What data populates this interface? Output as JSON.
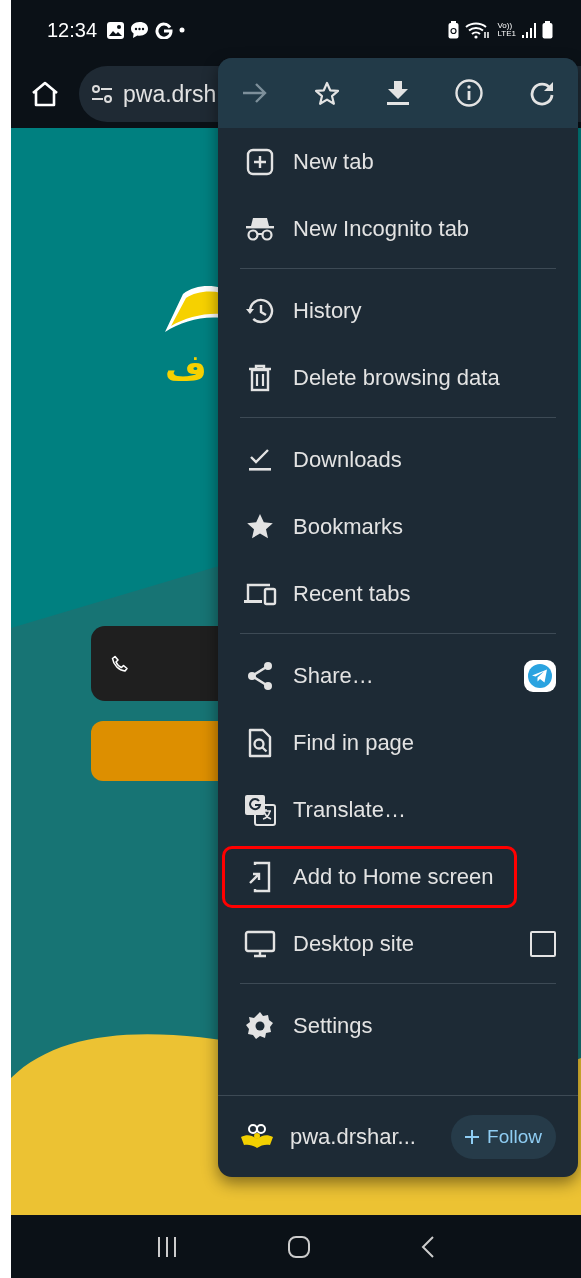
{
  "status_bar": {
    "time": "12:34",
    "network_label_top": "Vo))",
    "network_label_bottom": "LTE1"
  },
  "toolbar": {
    "url": "pwa.drsh"
  },
  "page": {
    "logo_text": "ف"
  },
  "menu": {
    "actions": [
      {
        "kind": "forward",
        "disabled": true
      },
      {
        "kind": "bookmark",
        "disabled": false
      },
      {
        "kind": "download",
        "disabled": false
      },
      {
        "kind": "info",
        "disabled": false
      },
      {
        "kind": "reload",
        "disabled": false
      }
    ],
    "sections": [
      {
        "items": [
          {
            "kind": "new-tab",
            "label": "New tab",
            "highlighted": false
          },
          {
            "kind": "incognito",
            "label": "New Incognito tab",
            "highlighted": false
          }
        ]
      },
      {
        "items": [
          {
            "kind": "history",
            "label": "History",
            "highlighted": false
          },
          {
            "kind": "delete",
            "label": "Delete browsing data",
            "highlighted": false
          }
        ]
      },
      {
        "items": [
          {
            "kind": "downloads",
            "label": "Downloads",
            "highlighted": false
          },
          {
            "kind": "bookmarks",
            "label": "Bookmarks",
            "highlighted": false
          },
          {
            "kind": "recent",
            "label": "Recent tabs",
            "highlighted": false
          }
        ]
      },
      {
        "items": [
          {
            "kind": "share",
            "label": "Share…",
            "highlighted": false
          },
          {
            "kind": "find",
            "label": "Find in page",
            "highlighted": false
          },
          {
            "kind": "translate",
            "label": "Translate…",
            "highlighted": false
          },
          {
            "kind": "add-home",
            "label": "Add to Home screen",
            "highlighted": true
          },
          {
            "kind": "desktop",
            "label": "Desktop site",
            "highlighted": false,
            "checked": false
          }
        ]
      },
      {
        "items": [
          {
            "kind": "settings",
            "label": "Settings",
            "highlighted": false
          }
        ]
      }
    ],
    "footer": {
      "site": "pwa.drshar...",
      "follow_label": "Follow"
    }
  }
}
